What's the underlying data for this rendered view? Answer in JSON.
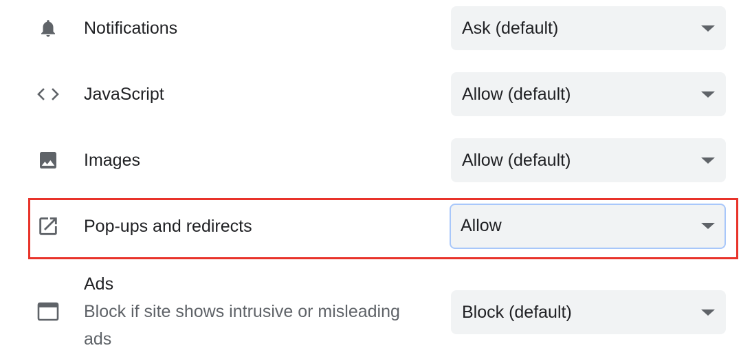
{
  "settings": [
    {
      "label": "Notifications",
      "icon": "bell-icon",
      "value": "Ask (default)"
    },
    {
      "label": "JavaScript",
      "icon": "code-icon",
      "value": "Allow (default)"
    },
    {
      "label": "Images",
      "icon": "image-icon",
      "value": "Allow (default)"
    },
    {
      "label": "Pop-ups and redirects",
      "icon": "open-in-new-icon",
      "value": "Allow"
    },
    {
      "label": "Ads",
      "description": "Block if site shows intrusive or misleading ads",
      "icon": "web-window-icon",
      "value": "Block (default)"
    }
  ],
  "highlight": {
    "color": "#e8332a"
  }
}
